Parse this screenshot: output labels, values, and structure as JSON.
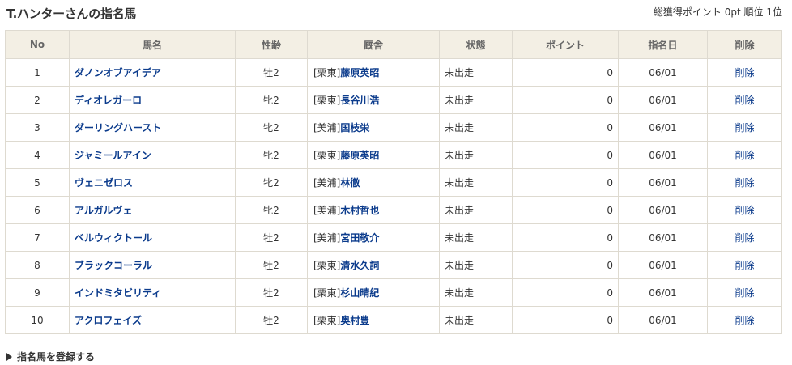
{
  "header": {
    "title": "T.ハンターさんの指名馬",
    "stats_label": "総獲得ポイント",
    "points": "0pt",
    "rank_label": "順位",
    "rank": "1位"
  },
  "table": {
    "columns": [
      "No",
      "馬名",
      "性齢",
      "厩舎",
      "状態",
      "ポイント",
      "指名日",
      "削除"
    ],
    "rows": [
      {
        "no": "1",
        "name": "ダノンオブアイデア",
        "sex_age": "牡2",
        "region": "[栗東]",
        "trainer": "藤原英昭",
        "status": "未出走",
        "points": "0",
        "date": "06/01",
        "delete": "削除"
      },
      {
        "no": "2",
        "name": "ディオレガーロ",
        "sex_age": "牝2",
        "region": "[栗東]",
        "trainer": "長谷川浩",
        "status": "未出走",
        "points": "0",
        "date": "06/01",
        "delete": "削除"
      },
      {
        "no": "3",
        "name": "ダーリングハースト",
        "sex_age": "牝2",
        "region": "[美浦]",
        "trainer": "国枝栄",
        "status": "未出走",
        "points": "0",
        "date": "06/01",
        "delete": "削除"
      },
      {
        "no": "4",
        "name": "ジャミールアイン",
        "sex_age": "牝2",
        "region": "[栗東]",
        "trainer": "藤原英昭",
        "status": "未出走",
        "points": "0",
        "date": "06/01",
        "delete": "削除"
      },
      {
        "no": "5",
        "name": "ヴェニゼロス",
        "sex_age": "牝2",
        "region": "[美浦]",
        "trainer": "林徹",
        "status": "未出走",
        "points": "0",
        "date": "06/01",
        "delete": "削除"
      },
      {
        "no": "6",
        "name": "アルガルヴェ",
        "sex_age": "牝2",
        "region": "[美浦]",
        "trainer": "木村哲也",
        "status": "未出走",
        "points": "0",
        "date": "06/01",
        "delete": "削除"
      },
      {
        "no": "7",
        "name": "ベルウィクトール",
        "sex_age": "牡2",
        "region": "[美浦]",
        "trainer": "宮田敬介",
        "status": "未出走",
        "points": "0",
        "date": "06/01",
        "delete": "削除"
      },
      {
        "no": "8",
        "name": "ブラックコーラル",
        "sex_age": "牡2",
        "region": "[栗東]",
        "trainer": "清水久詞",
        "status": "未出走",
        "points": "0",
        "date": "06/01",
        "delete": "削除"
      },
      {
        "no": "9",
        "name": "インドミタビリティ",
        "sex_age": "牡2",
        "region": "[栗東]",
        "trainer": "杉山晴紀",
        "status": "未出走",
        "points": "0",
        "date": "06/01",
        "delete": "削除"
      },
      {
        "no": "10",
        "name": "アクロフェイズ",
        "sex_age": "牡2",
        "region": "[栗東]",
        "trainer": "奥村豊",
        "status": "未出走",
        "points": "0",
        "date": "06/01",
        "delete": "削除"
      }
    ]
  },
  "footer": {
    "register_label": "指名馬を登録する",
    "register_icon": "triangle-right-icon"
  },
  "colors": {
    "link": "#0b3b8c",
    "header_bg": "#f3efe4",
    "border": "#dedad0"
  }
}
